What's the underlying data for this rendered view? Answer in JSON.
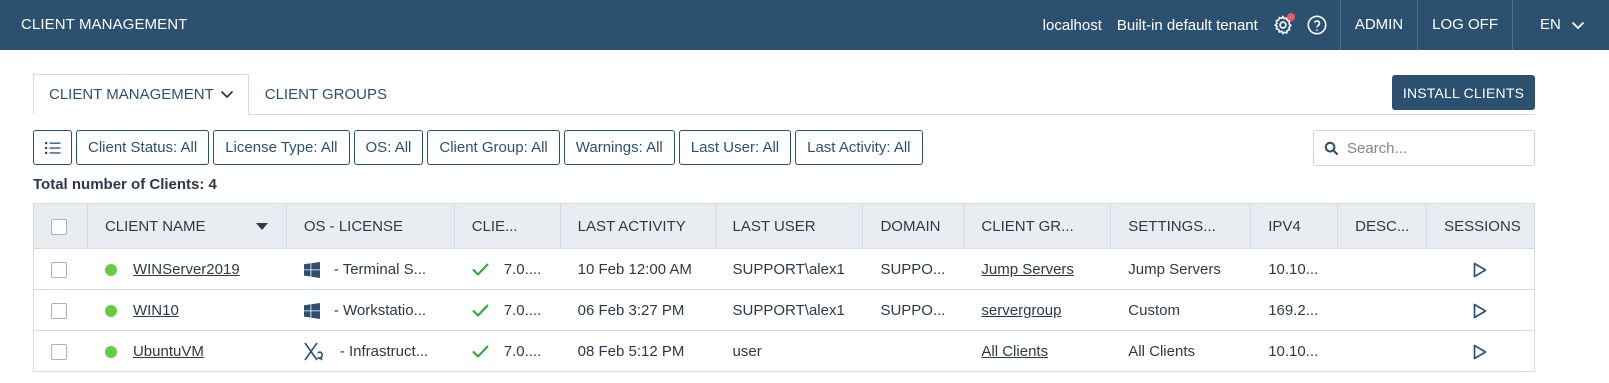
{
  "topbar": {
    "title": "CLIENT MANAGEMENT",
    "host": "localhost",
    "tenant": "Built-in default tenant",
    "settings_icon": "gear-icon",
    "help_icon": "help-circle-icon",
    "admin": "ADMIN",
    "logoff": "LOG OFF",
    "language": "EN"
  },
  "tabs": [
    {
      "label": "CLIENT MANAGEMENT",
      "active": true
    },
    {
      "label": "CLIENT GROUPS",
      "active": false
    }
  ],
  "install_button": "INSTALL CLIENTS",
  "filters": [
    "Client Status: All",
    "License Type: All",
    "OS: All",
    "Client Group: All",
    "Warnings: All",
    "Last User: All",
    "Last Activity: All"
  ],
  "search": {
    "placeholder": "Search..."
  },
  "total_label": "Total number of Clients: 4",
  "table": {
    "columns": [
      "CLIENT NAME",
      "OS - LICENSE",
      "CLIE...",
      "LAST ACTIVITY",
      "LAST USER",
      "DOMAIN",
      "CLIENT GR...",
      "SETTINGS...",
      "IPV4",
      "DESC...",
      "SESSIONS"
    ],
    "rows": [
      {
        "status": "online",
        "name": "WINServer2019",
        "os_icon": "windows-icon",
        "os_license": "- Terminal S...",
        "client_version": "7.0....",
        "last_activity": "10 Feb 12:00 AM",
        "last_user": "SUPPORT\\alex1",
        "domain": "SUPPO...",
        "client_group": "Jump Servers",
        "settings": "Jump Servers",
        "ipv4": "10.10...",
        "description": ""
      },
      {
        "status": "online",
        "name": "WIN10",
        "os_icon": "windows-icon",
        "os_license": "- Workstatio...",
        "client_version": "7.0....",
        "last_activity": "06 Feb 3:27 PM",
        "last_user": "SUPPORT\\alex1",
        "domain": "SUPPO...",
        "client_group": "servergroup",
        "settings": "Custom",
        "ipv4": "169.2...",
        "description": ""
      },
      {
        "status": "online",
        "name": "UbuntuVM",
        "os_icon": "linux-x-icon",
        "os_license": "- Infrastruct...",
        "client_version": "7.0....",
        "last_activity": "08 Feb 5:12 PM",
        "last_user": "user",
        "domain": "",
        "client_group": "All Clients",
        "settings": "All Clients",
        "ipv4": "10.10...",
        "description": ""
      }
    ]
  },
  "colors": {
    "topbar": "#2c5170",
    "online": "#66cc44",
    "check": "#22aa33",
    "notification": "#e8596a"
  }
}
